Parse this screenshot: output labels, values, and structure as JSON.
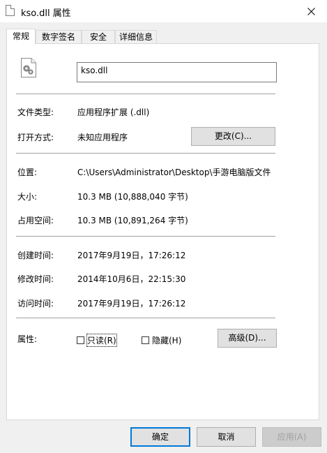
{
  "window": {
    "title": "kso.dll 属性"
  },
  "tabs": [
    "常规",
    "数字签名",
    "安全",
    "详细信息"
  ],
  "general": {
    "file_name": "kso.dll",
    "file_type_label": "文件类型:",
    "file_type_value": "应用程序扩展 (.dll)",
    "opens_with_label": "打开方式:",
    "opens_with_value": "未知应用程序",
    "change_button": "更改(C)...",
    "location_label": "位置:",
    "location_value": "C:\\Users\\Administrator\\Desktop\\手游电脑版文件",
    "size_label": "大小:",
    "size_value": "10.3 MB (10,888,040 字节)",
    "size_on_disk_label": "占用空间:",
    "size_on_disk_value": "10.3 MB (10,891,264 字节)",
    "created_label": "创建时间:",
    "created_value": "2017年9月19日，17:26:12",
    "modified_label": "修改时间:",
    "modified_value": "2014年10月6日，22:15:30",
    "accessed_label": "访问时间:",
    "accessed_value": "2017年9月19日，17:26:12",
    "attributes_label": "属性:",
    "readonly_label": "只读(R)",
    "hidden_label": "隐藏(H)",
    "advanced_button": "高级(D)..."
  },
  "footer": {
    "ok": "确定",
    "cancel": "取消",
    "apply": "应用(A)"
  },
  "icons": {
    "title": "file-icon",
    "close": "close-icon",
    "dll": "dll-gear-file-icon"
  }
}
